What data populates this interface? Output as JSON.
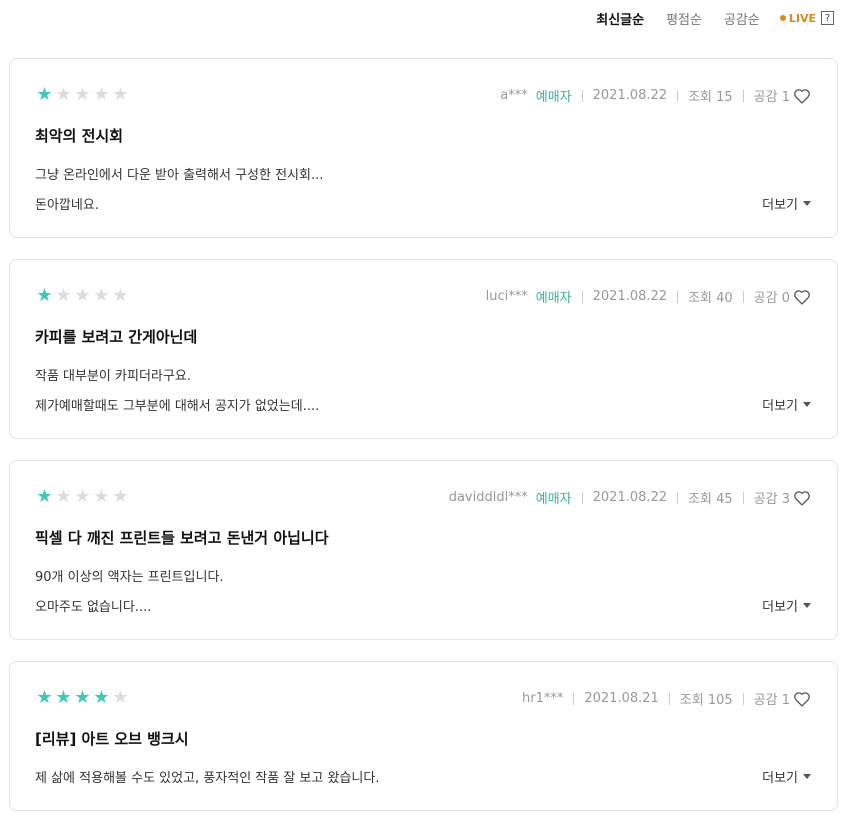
{
  "sort": {
    "options": [
      "최신글순",
      "평점순",
      "공감순"
    ],
    "live_label": "LIVE",
    "help_label": "?"
  },
  "colors": {
    "star_on": "#3ec8b9",
    "star_off": "#dcdcdc",
    "buyer": "#3eaea0",
    "live": "#d98a1e"
  },
  "labels": {
    "likes_prefix": "공감",
    "views_prefix": "조회",
    "more": "더보기"
  },
  "reviews": [
    {
      "rating": 1,
      "user": "a***",
      "buyer": "예매자",
      "date": "2021.08.22",
      "views": "조회 15",
      "likes": "공감 1",
      "title": "최악의 전시회",
      "line1": "그냥 온라인에서 다운 받아 출력해서 구성한 전시회...",
      "line2": "돈아깝네요.",
      "more": "더보기"
    },
    {
      "rating": 1,
      "user": "luci***",
      "buyer": "예매자",
      "date": "2021.08.22",
      "views": "조회 40",
      "likes": "공감 0",
      "title": "카피를 보려고 간게아닌데",
      "line1": "작품 대부분이 카피더라구요.",
      "line2": "제가예매할때도 그부분에 대해서 공지가 없었는데....",
      "more": "더보기"
    },
    {
      "rating": 1,
      "user": "daviddldl***",
      "buyer": "예매자",
      "date": "2021.08.22",
      "views": "조회 45",
      "likes": "공감 3",
      "title": "픽셀 다 깨진 프린트들 보려고 돈낸거 아닙니다",
      "line1": "90개 이상의 액자는 프린트입니다.",
      "line2": "오마주도 없습니다....",
      "more": "더보기"
    },
    {
      "rating": 4,
      "user": "hr1***",
      "date": "2021.08.21",
      "views": "조회 105",
      "likes": "공감 1",
      "title": "[리뷰] 아트 오브 뱅크시",
      "line1": "제 삶에 적용해볼 수도 있었고, 풍자적인 작품 잘 보고 왔습니다.",
      "more": "더보기"
    }
  ]
}
